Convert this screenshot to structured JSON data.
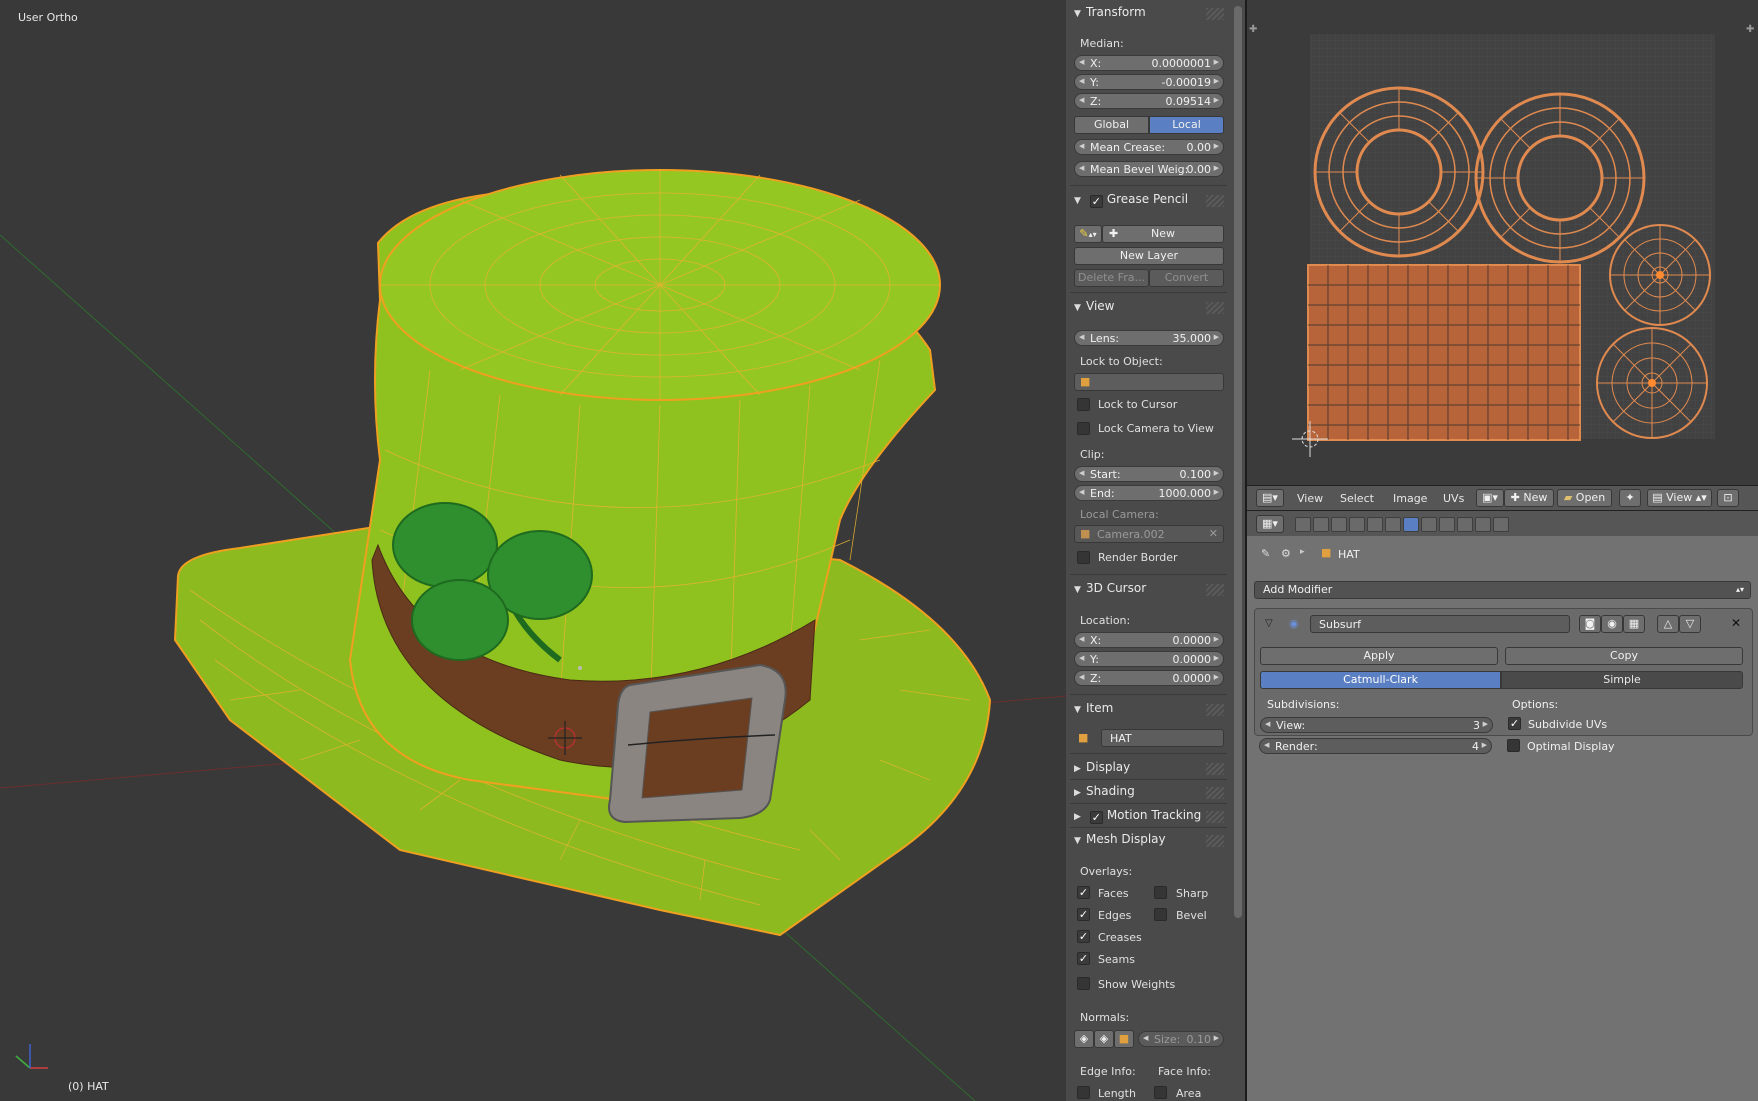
{
  "viewport": {
    "view_name": "User Ortho",
    "object_label": "(0) HAT"
  },
  "transform": {
    "title": "Transform",
    "median_label": "Median:",
    "x_label": "X:",
    "x_value": "0.0000001",
    "y_label": "Y:",
    "y_value": "-0.00019",
    "z_label": "Z:",
    "z_value": "0.09514",
    "global_label": "Global",
    "local_label": "Local",
    "mean_crease_label": "Mean Crease:",
    "mean_crease_value": "0.00",
    "mean_bevel_label": "Mean Bevel Weig:",
    "mean_bevel_value": "0.00"
  },
  "grease_pencil": {
    "title": "Grease Pencil",
    "new_label": "New",
    "new_layer_label": "New Layer",
    "delete_frame_label": "Delete Fra...",
    "convert_label": "Convert"
  },
  "view": {
    "title": "View",
    "lens_label": "Lens:",
    "lens_value": "35.000",
    "lock_object_label": "Lock to Object:",
    "lock_cursor_label": "Lock to Cursor",
    "lock_camera_label": "Lock Camera to View",
    "clip_label": "Clip:",
    "start_label": "Start:",
    "start_value": "0.100",
    "end_label": "End:",
    "end_value": "1000.000",
    "local_camera_label": "Local Camera:",
    "local_camera_value": "Camera.002",
    "render_border_label": "Render Border"
  },
  "cursor": {
    "title": "3D Cursor",
    "location_label": "Location:",
    "x_label": "X:",
    "x_value": "0.0000",
    "y_label": "Y:",
    "y_value": "0.0000",
    "z_label": "Z:",
    "z_value": "0.0000"
  },
  "item": {
    "title": "Item",
    "name": "HAT"
  },
  "collapsed_panels": {
    "display": "Display",
    "shading": "Shading",
    "motion_tracking": "Motion Tracking"
  },
  "mesh_display": {
    "title": "Mesh Display",
    "overlays_label": "Overlays:",
    "faces": "Faces",
    "sharp": "Sharp",
    "edges": "Edges",
    "bevel": "Bevel",
    "creases": "Creases",
    "seams": "Seams",
    "show_weights": "Show Weights",
    "normals_label": "Normals:",
    "size_label": "Size:",
    "size_value": "0.10",
    "edge_info_label": "Edge Info:",
    "face_info_label": "Face Info:",
    "length": "Length",
    "area": "Area"
  },
  "uv_header": {
    "view": "View",
    "select": "Select",
    "image": "Image",
    "uvs": "UVs",
    "new": "New",
    "open": "Open",
    "view2": "View"
  },
  "properties": {
    "object_name": "HAT",
    "add_modifier": "Add Modifier",
    "modifier_name": "Subsurf",
    "apply": "Apply",
    "copy": "Copy",
    "catmull": "Catmull-Clark",
    "simple": "Simple",
    "subdivisions_label": "Subdivisions:",
    "options_label": "Options:",
    "view_label": "View:",
    "view_value": "3",
    "render_label": "Render:",
    "render_value": "4",
    "subdivide_uvs": "Subdivide UVs",
    "optimal_display": "Optimal Display"
  },
  "colors": {
    "accent": "#5a7fc2",
    "mesh_face": "#8fbf1f",
    "mesh_wire": "#f0a020",
    "band": "#6b3e22"
  }
}
